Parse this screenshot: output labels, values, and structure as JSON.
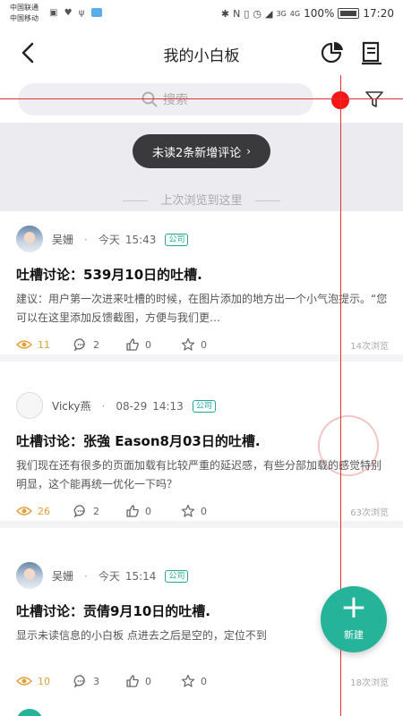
{
  "status_bar": {
    "carrier1": "中国联通",
    "carrier2": "中国移动",
    "signal_4g": "4G",
    "signal_3g": "3G",
    "battery_pct": "100%",
    "time": "17:20"
  },
  "nav": {
    "title": "我的小白板"
  },
  "search": {
    "placeholder": "搜索"
  },
  "banner": {
    "unread_pill": "未读2条新增评论",
    "last_read": "上次浏览到这里"
  },
  "posts": [
    {
      "author": "吴姗",
      "day": "今天",
      "time": "15:43",
      "tag": "公司",
      "title": "吐槽讨论：539月10日的吐槽.",
      "body": "建议：用户第一次进来吐槽的时候，在图片添加的地方出一个小气泡提示。“您可以在这里添加反馈截图，方便与我们更…",
      "views": "11",
      "comments": "2",
      "likes": "0",
      "stars": "0",
      "view_count": "14次浏览"
    },
    {
      "author": "Vicky燕",
      "day": "08-29",
      "time": "14:13",
      "tag": "公司",
      "title": "吐槽讨论：张強  Eason8月03日的吐槽.",
      "body": "我们现在还有很多的页面加载有比较严重的延迟感，有些分部加载的感觉特别明显，这个能再统一优化一下吗？",
      "views": "26",
      "comments": "2",
      "likes": "0",
      "stars": "0",
      "view_count": "63次浏览"
    },
    {
      "author": "吴姗",
      "day": "今天",
      "time": "15:14",
      "tag": "公司",
      "title": "吐槽讨论：贡倩9月10日的吐槽.",
      "body": "显示未读信息的小白板 点进去之后是空的，定位不到",
      "views": "10",
      "comments": "3",
      "likes": "0",
      "stars": "0",
      "view_count": "18次浏览"
    }
  ],
  "fab": {
    "label": "新建"
  },
  "colors": {
    "accent": "#25b39a",
    "views_accent": "#e2a03a",
    "pill_bg": "#3a3a3c",
    "red_marker": "#ff1414"
  }
}
